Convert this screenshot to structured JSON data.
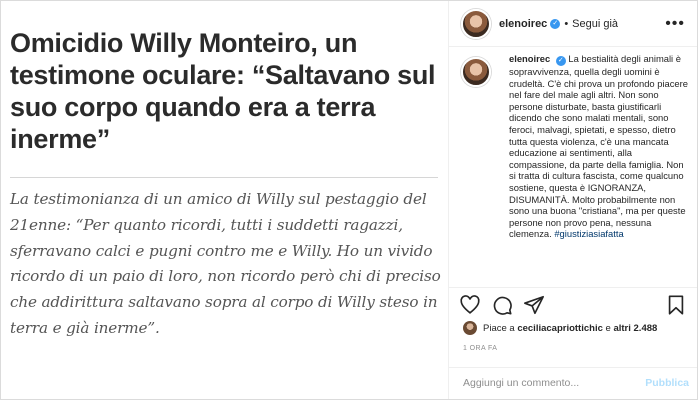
{
  "post_image": {
    "headline": "Omicidio Willy Monteiro, un testimone oculare: “Saltavano sul suo corpo quando era a terra inerme”",
    "article_text": "La testimonianza di un amico di Willy sul pestaggio del 21enne: “Per quanto ricordi, tutti i suddetti ragazzi, sferravano calci e pugni contro me e Willy. Ho un vivido ricordo di un paio di loro, non ricordo però chi di preciso che addirittura saltavano sopra al corpo di Willy steso in terra e già inerme”."
  },
  "header": {
    "username": "elenoirec",
    "verified_icon": "verified-badge-icon",
    "separator": "•",
    "follow_label": "Segui già",
    "more_icon": "more-options-icon"
  },
  "caption": {
    "username": "elenoirec",
    "text": "La bestialità degli animali è sopravvivenza, quella degli uomini è crudeltà. C'è chi prova un profondo piacere nel fare del male agli altri. Non sono persone disturbate, basta giustificarli dicendo che sono malati mentali, sono feroci, malvagi, spietati, e spesso, dietro tutta questa violenza, c'è una mancata educazione ai sentimenti, alla compassione, da parte della famiglia. Non si tratta di cultura fascista, come qualcuno sostiene, questa è IGNORANZA, DISUMANITÀ. Molto probabilmente non sono una buona \"cristiana\", ma per queste persone non provo pena, nessuna clemenza.",
    "hashtag": "#giustiziasiafatta"
  },
  "actions": {
    "like_icon": "heart-icon",
    "comment_icon": "comment-icon",
    "share_icon": "share-icon",
    "save_icon": "bookmark-icon"
  },
  "likes": {
    "prefix": "Piace a ",
    "user": "ceciliacapriottichic",
    "middle": " e ",
    "others": "altri 2.488"
  },
  "timestamp": "1 ORA FA",
  "comment": {
    "placeholder": "Aggiungi un commento...",
    "publish_label": "Pubblica"
  }
}
